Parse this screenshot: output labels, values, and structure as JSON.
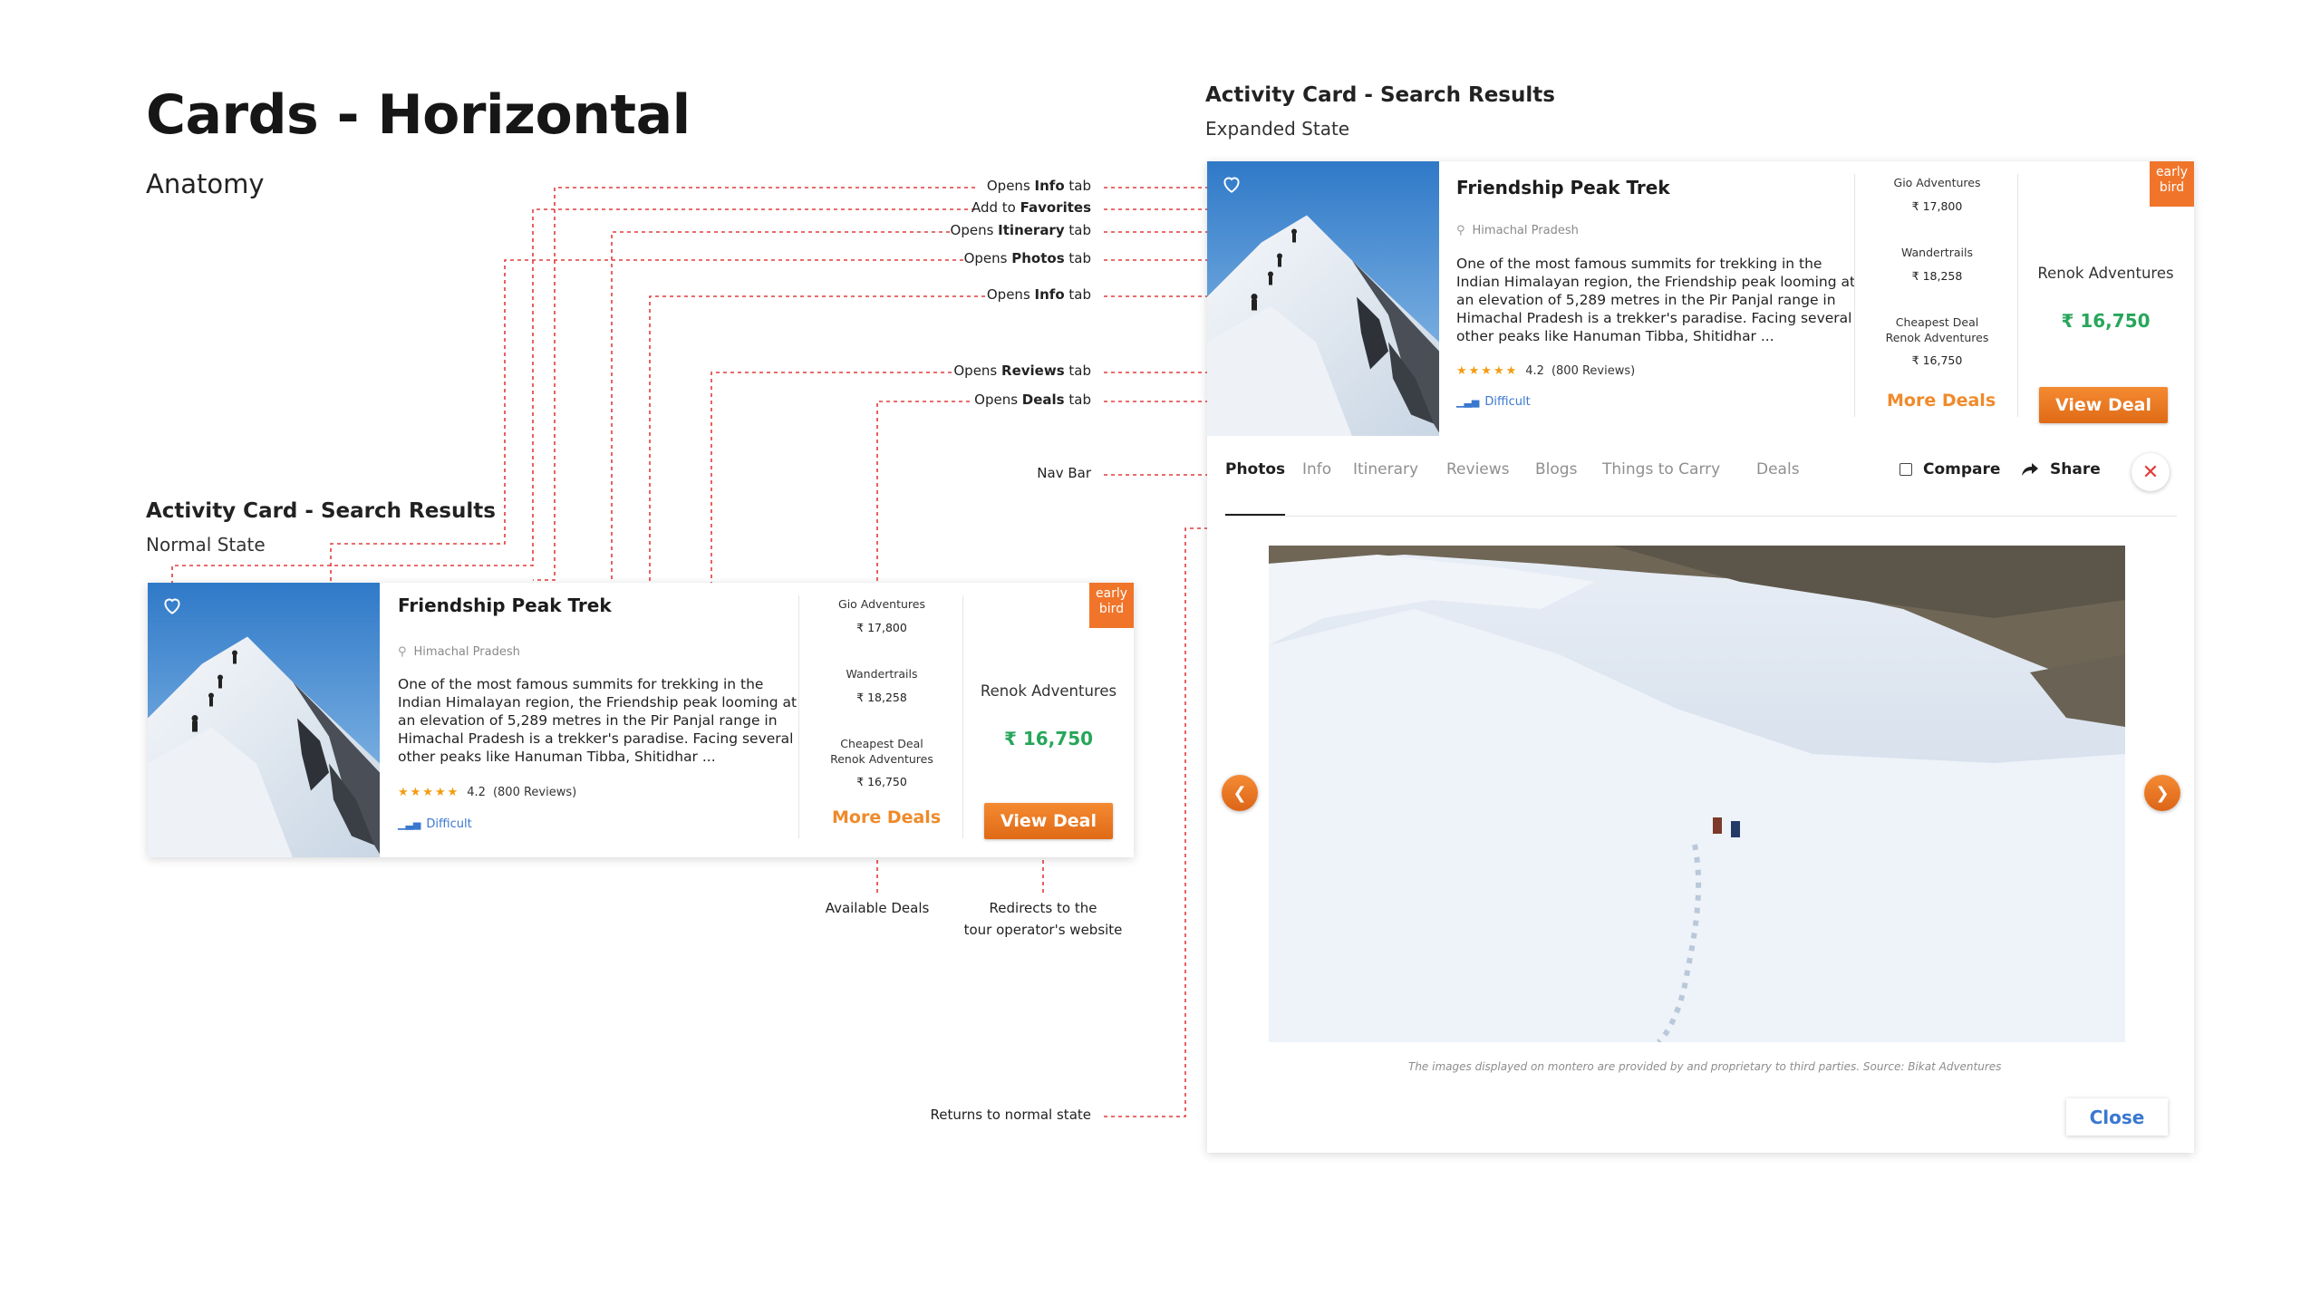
{
  "page": {
    "title": "Cards - Horizontal",
    "subtitle": "Anatomy"
  },
  "normal_section": {
    "title": "Activity Card - Search Results",
    "subtitle": "Normal State"
  },
  "expanded_section": {
    "title": "Activity Card - Search Results",
    "subtitle": "Expanded State"
  },
  "card": {
    "title": "Friendship Peak Trek",
    "location": "Himachal Pradesh",
    "description": "One of the most famous summits for trekking in the Indian Himalayan region, the Friendship peak looming at an elevation of 5,289 metres in the Pir Panjal range in Himachal Pradesh is a trekker's paradise. Facing several other peaks like Hanuman Tibba, Shitidhar ...",
    "rating": "4.2",
    "rating_value": 4.2,
    "reviews": "(800 Reviews)",
    "difficulty": "Difficult",
    "operators": [
      {
        "name": "Gio Adventures",
        "price": "₹ 17,800"
      },
      {
        "name": "Wandertrails",
        "price": "₹ 18,258"
      }
    ],
    "cheapest": {
      "label": "Cheapest Deal",
      "name": "Renok Adventures",
      "price": "₹ 16,750"
    },
    "best_deal": {
      "name": "Renok Adventures",
      "price": "₹ 16,750"
    },
    "more_deals": "More Deals",
    "view_deal": "View Deal",
    "badge": [
      "early",
      "bird"
    ]
  },
  "annotations": {
    "right": [
      {
        "pre": "Opens ",
        "bold": "Info",
        "post": " tab"
      },
      {
        "pre": "Add to ",
        "bold": "Favorites",
        "post": ""
      },
      {
        "pre": "Opens ",
        "bold": "Itinerary",
        "post": " tab"
      },
      {
        "pre": "Opens ",
        "bold": "Photos",
        "post": " tab"
      },
      {
        "pre": "Opens ",
        "bold": "Info",
        "post": " tab"
      },
      {
        "pre": "Opens ",
        "bold": "Reviews",
        "post": " tab"
      },
      {
        "pre": "Opens ",
        "bold": "Deals",
        "post": " tab"
      }
    ],
    "nav_bar": "Nav Bar",
    "available_deals": "Available Deals",
    "redirects": [
      "Redirects to the",
      "tour operator's website"
    ],
    "returns": "Returns to normal state"
  },
  "nav": {
    "tabs": [
      "Photos",
      "Info",
      "Itinerary",
      "Reviews",
      "Blogs",
      "Things to Carry",
      "Deals"
    ],
    "active": "Photos",
    "compare": "Compare",
    "share": "Share"
  },
  "gallery": {
    "caption_pre": "The images displayed on montero are provided by and proprietary to third parties. ",
    "caption_src": "Source: Bikat Adventures"
  },
  "close_label": "Close",
  "icons": [
    "heart-icon",
    "location-pin-icon",
    "star-icon",
    "signal-bars-icon",
    "share-arrow-icon",
    "close-icon",
    "chevron-left-icon",
    "chevron-right-icon"
  ],
  "colors": {
    "accent": "#f0752b",
    "price_green": "#27a65a",
    "link_blue": "#3a78d0",
    "annotation_red": "#e23b3b"
  }
}
